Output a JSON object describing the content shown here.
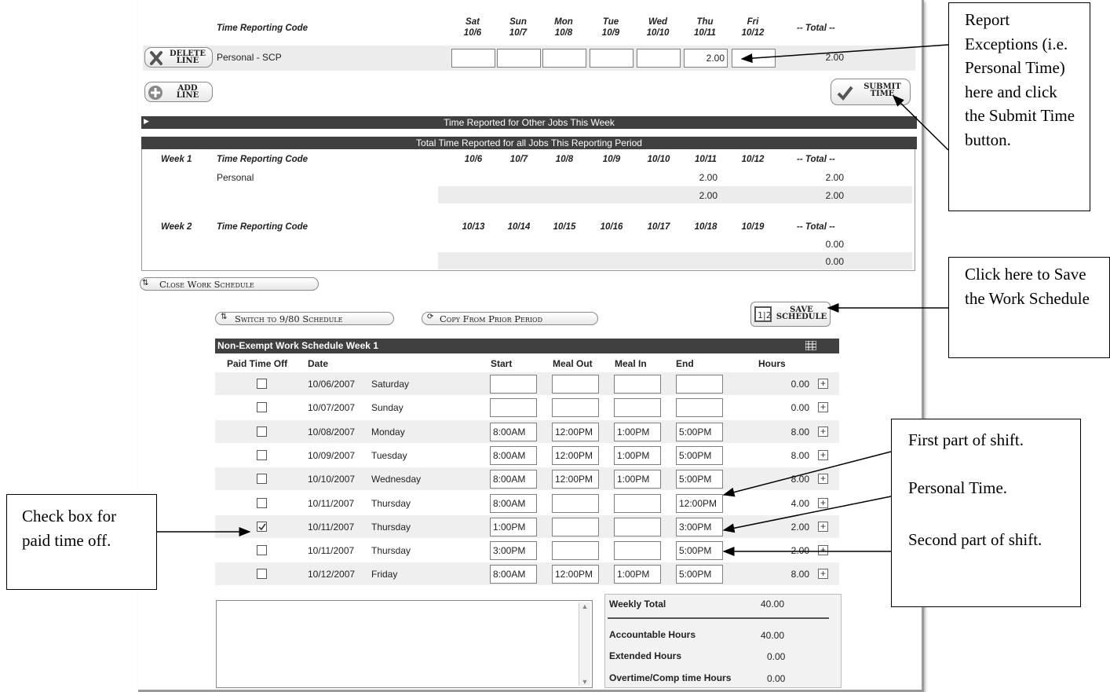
{
  "reporting": {
    "code_header": "Time Reporting Code",
    "days": [
      {
        "dow": "Sat",
        "date": "10/6"
      },
      {
        "dow": "Sun",
        "date": "10/7"
      },
      {
        "dow": "Mon",
        "date": "10/8"
      },
      {
        "dow": "Tue",
        "date": "10/9"
      },
      {
        "dow": "Wed",
        "date": "10/10"
      },
      {
        "dow": "Thu",
        "date": "10/11"
      },
      {
        "dow": "Fri",
        "date": "10/12"
      }
    ],
    "total_header": "-- Total --",
    "line_code": "Personal - SCP",
    "line_values": [
      "",
      "",
      "",
      "",
      "",
      "2.00",
      ""
    ],
    "line_total": "2.00",
    "delete_line_label": [
      "DELETE",
      "LINE"
    ],
    "add_line_label": [
      "ADD",
      "LINE"
    ],
    "submit_time_label": [
      "SUBMIT",
      "TIME"
    ]
  },
  "other_jobs_bar": "Time Reported for Other Jobs This Week",
  "period_bar": "Total Time Reported for all Jobs This Reporting Period",
  "week1": {
    "label": "Week 1",
    "code_header": "Time Reporting Code",
    "dates": [
      "10/6",
      "10/7",
      "10/8",
      "10/9",
      "10/10",
      "10/11",
      "10/12"
    ],
    "total_header": "-- Total --",
    "row_code": "Personal",
    "row_thu": "2.00",
    "row_total": "2.00",
    "sum_thu": "2.00",
    "sum_total": "2.00"
  },
  "week2": {
    "label": "Week 2",
    "code_header": "Time Reporting Code",
    "dates": [
      "10/13",
      "10/14",
      "10/15",
      "10/16",
      "10/17",
      "10/18",
      "10/19"
    ],
    "total_header": "-- Total --",
    "row_total": "0.00",
    "sum_total": "0.00"
  },
  "close_schedule_label": "Close Work Schedule",
  "switch_schedule_label": "Switch to 9/80 Schedule",
  "copy_prior_label": "Copy From Prior Period",
  "save_schedule_label": [
    "SAVE",
    "SCHEDULE"
  ],
  "schedule": {
    "title": "Non-Exempt Work Schedule Week 1",
    "headers": {
      "pto": "Paid Time Off",
      "date": "Date",
      "start": "Start",
      "meal_out": "Meal Out",
      "meal_in": "Meal In",
      "end": "End",
      "hours": "Hours"
    },
    "rows": [
      {
        "date": "10/06/2007",
        "day": "Saturday",
        "start": "",
        "meal_out": "",
        "meal_in": "",
        "end": "",
        "hours": "0.00",
        "checked": false
      },
      {
        "date": "10/07/2007",
        "day": "Sunday",
        "start": "",
        "meal_out": "",
        "meal_in": "",
        "end": "",
        "hours": "0.00",
        "checked": false
      },
      {
        "date": "10/08/2007",
        "day": "Monday",
        "start": "8:00AM",
        "meal_out": "12:00PM",
        "meal_in": "1:00PM",
        "end": "5:00PM",
        "hours": "8.00",
        "checked": false
      },
      {
        "date": "10/09/2007",
        "day": "Tuesday",
        "start": "8:00AM",
        "meal_out": "12:00PM",
        "meal_in": "1:00PM",
        "end": "5:00PM",
        "hours": "8.00",
        "checked": false
      },
      {
        "date": "10/10/2007",
        "day": "Wednesday",
        "start": "8:00AM",
        "meal_out": "12:00PM",
        "meal_in": "1:00PM",
        "end": "5:00PM",
        "hours": "8.00",
        "checked": false
      },
      {
        "date": "10/11/2007",
        "day": "Thursday",
        "start": "8:00AM",
        "meal_out": "",
        "meal_in": "",
        "end": "12:00PM",
        "hours": "4.00",
        "checked": false
      },
      {
        "date": "10/11/2007",
        "day": "Thursday",
        "start": "1:00PM",
        "meal_out": "",
        "meal_in": "",
        "end": "3:00PM",
        "hours": "2.00",
        "checked": true
      },
      {
        "date": "10/11/2007",
        "day": "Thursday",
        "start": "3:00PM",
        "meal_out": "",
        "meal_in": "",
        "end": "5:00PM",
        "hours": "2.00",
        "checked": false
      },
      {
        "date": "10/12/2007",
        "day": "Friday",
        "start": "8:00AM",
        "meal_out": "12:00PM",
        "meal_in": "1:00PM",
        "end": "5:00PM",
        "hours": "8.00",
        "checked": false
      }
    ]
  },
  "summary": {
    "weekly_total_label": "Weekly Total",
    "weekly_total": "40.00",
    "accountable_label": "Accountable Hours",
    "accountable": "40.00",
    "extended_label": "Extended Hours",
    "extended": "0.00",
    "overtime_label": "Overtime/Comp time Hours",
    "overtime": "0.00"
  },
  "callouts": {
    "report_exceptions": "Report Exceptions (i.e. Personal Time) here and click the Submit Time button.",
    "save_schedule": "Click here to Save the Work Schedule",
    "shift_first": "First part of shift.",
    "shift_personal": "Personal Time.",
    "shift_second": "Second part of shift.",
    "check_box": "Check box for paid time off."
  }
}
